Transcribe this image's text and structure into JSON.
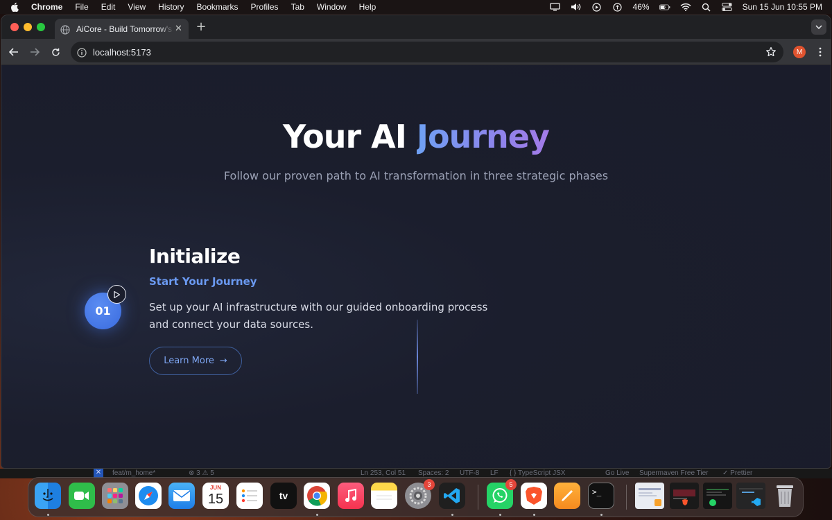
{
  "menubar": {
    "app_name": "Chrome",
    "items": [
      "File",
      "Edit",
      "View",
      "History",
      "Bookmarks",
      "Profiles",
      "Tab",
      "Window",
      "Help"
    ],
    "battery": "46%",
    "datetime": "Sun 15 Jun  10:55 PM"
  },
  "browser": {
    "tab_title": "AiCore - Build Tomorrow's Intelligence",
    "url": "localhost:5173",
    "profile_initial": "M"
  },
  "hero": {
    "title_part1": "Your AI ",
    "title_accent": "Journey",
    "subtitle": "Follow our proven path to AI transformation in three strategic phases"
  },
  "step": {
    "number": "01",
    "title": "Initialize",
    "subtitle": "Start Your Journey",
    "description": "Set up your AI infrastructure with our guided onboarding process and connect your data sources.",
    "button_label": "Learn More",
    "button_arrow": "→"
  },
  "statusbar": {
    "close": "✕",
    "branch": "feat/m_home*",
    "problems": "⊗ 3 ⚠ 5",
    "position": "Ln 253, Col 51",
    "spaces": "Spaces: 2",
    "encoding": "UTF-8",
    "eol": "LF",
    "language": "{ } TypeScript JSX",
    "golive": "Go Live",
    "supermaven": "Supermaven Free Tier",
    "prettier": "✓ Prettier"
  },
  "dock": {
    "calendar_month": "JUN",
    "calendar_day": "15",
    "tv_label": "tv",
    "settings_badge": "3",
    "whatsapp_badge": "5",
    "terminal_prompt": ">_"
  },
  "colors": {
    "page_bg": "#1b1e2d",
    "accent_blue": "#6b9af2",
    "accent_purple": "#a37be8",
    "badge_blue": "#4a7be8"
  }
}
